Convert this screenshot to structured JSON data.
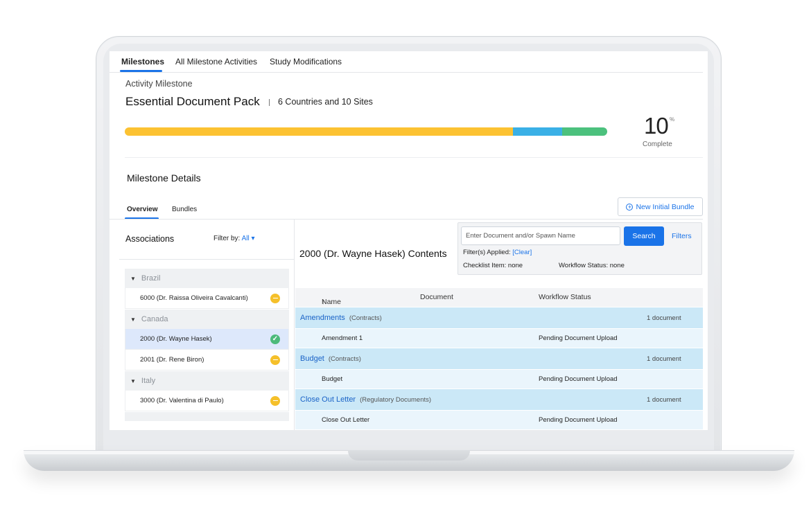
{
  "top_tabs": [
    "Milestones",
    "All Milestone Activities",
    "Study Modifications"
  ],
  "header": {
    "activity_label": "Activity Milestone",
    "title": "Essential Document Pack",
    "subtitle": "6 Countries and 10 Sites"
  },
  "progress": {
    "segments": [
      {
        "fraction": 0.805,
        "color": "#fcc232"
      },
      {
        "fraction": 0.102,
        "color": "#3ab0e6"
      },
      {
        "fraction": 0.093,
        "color": "#4cc17d"
      }
    ],
    "percent_value": "10",
    "percent_sign": "%",
    "complete_label": "Complete"
  },
  "details": {
    "title": "Milestone Details",
    "tabs": [
      "Overview",
      "Bundles"
    ],
    "new_bundle_label": "New Initial Bundle"
  },
  "associations": {
    "title": "Associations",
    "filter_label": "Filter by:",
    "filter_value": "All",
    "countries": [
      {
        "name": "Brazil",
        "sites": [
          {
            "label": "6000 (Dr. Raissa Oliveira Cavalcanti)",
            "status": "pending"
          }
        ]
      },
      {
        "name": "Canada",
        "sites": [
          {
            "label": "2000 (Dr. Wayne Hasek)",
            "status": "done",
            "selected": true
          },
          {
            "label": "2001 (Dr. Rene Biron)",
            "status": "pending"
          }
        ]
      },
      {
        "name": "Italy",
        "sites": [
          {
            "label": "3000 (Dr. Valentina di Paulo)",
            "status": "pending"
          }
        ]
      }
    ]
  },
  "contents": {
    "title": "2000 (Dr. Wayne Hasek) Contents",
    "search_placeholder": "Enter Document and/or Spawn Name",
    "search_button": "Search",
    "filters_link": "Filters",
    "filters_applied_label": "Filter(s) Applied:",
    "filters_clear": "[Clear]",
    "checklist_filter": "Checklist Item: none",
    "workflow_filter": "Workflow Status: none",
    "columns": [
      "Name",
      "Document",
      "Workflow Status"
    ],
    "groups": [
      {
        "name": "Amendments",
        "type": "(Contracts)",
        "count": "1 document",
        "items": [
          {
            "name": "Amendment 1",
            "status": "Pending Document Upload"
          }
        ]
      },
      {
        "name": "Budget",
        "type": "(Contracts)",
        "count": "1 document",
        "items": [
          {
            "name": "Budget",
            "status": "Pending Document Upload"
          }
        ]
      },
      {
        "name": "Close Out Letter",
        "type": "(Regulatory Documents)",
        "count": "1 document",
        "items": [
          {
            "name": "Close Out Letter",
            "status": "Pending Document Upload"
          }
        ]
      }
    ]
  }
}
